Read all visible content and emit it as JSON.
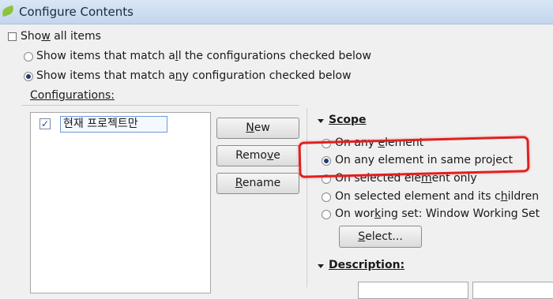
{
  "window": {
    "title": "Configure Contents"
  },
  "show_all": {
    "label_pre": "Sho",
    "label_acc": "w",
    "label_post": " all items",
    "checked": false
  },
  "match_mode": {
    "all": {
      "pre": "Show items that match a",
      "acc": "l",
      "post": "l the configurations checked below",
      "selected": false
    },
    "any": {
      "pre": "Show items that match a",
      "acc": "n",
      "post": "y configuration checked below",
      "selected": true
    }
  },
  "configurations": {
    "label": "Configurations:",
    "items": [
      {
        "label": "현재 프로젝트만",
        "checked": true
      }
    ]
  },
  "buttons": {
    "new": {
      "acc": "N",
      "post": "ew"
    },
    "remove": {
      "pre": "Remo",
      "acc": "v",
      "post": "e"
    },
    "rename": {
      "acc": "R",
      "post": "ename"
    }
  },
  "scope": {
    "title": "Scope",
    "options": [
      {
        "pre": "On any ",
        "acc": "e",
        "post": "lement",
        "selected": false
      },
      {
        "pre": "On any element in same pro",
        "acc": "j",
        "post": "ect",
        "selected": true
      },
      {
        "pre": "On selected ele",
        "acc": "m",
        "post": "ent only",
        "selected": false
      },
      {
        "pre": "On selected element and its c",
        "acc": "h",
        "post": "ildren",
        "selected": false
      },
      {
        "pre": "On wor",
        "acc": "k",
        "post": "ing set:  Window Working Set",
        "selected": false
      }
    ],
    "select_button": {
      "pre": "",
      "acc": "S",
      "post": "elect..."
    }
  },
  "description": {
    "title": "Description:"
  },
  "colors": {
    "highlight": "#e02020",
    "titlebar": "#c9daf0"
  }
}
